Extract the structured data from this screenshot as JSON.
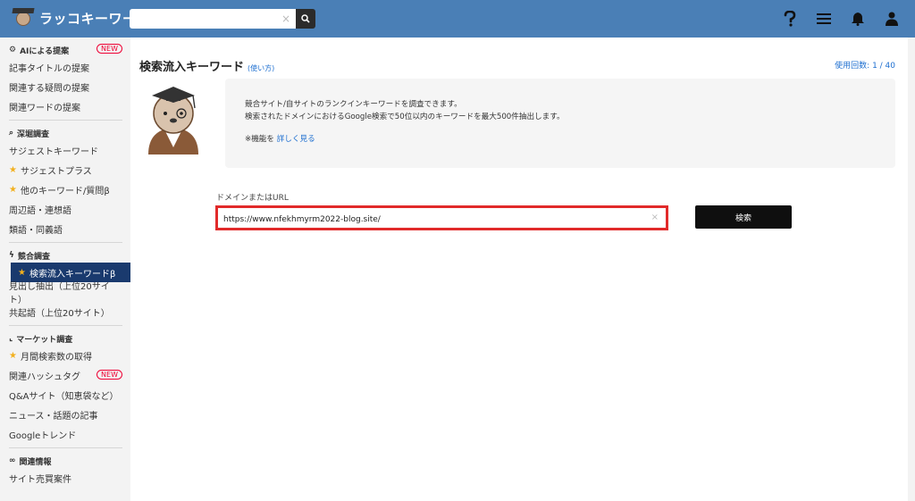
{
  "app": {
    "title": "ラッコキーワード"
  },
  "header": {
    "search_value": "",
    "icons": [
      "help-icon",
      "menu-icon",
      "bell-icon",
      "user-icon"
    ],
    "clear_glyph": "×"
  },
  "sidebar": {
    "sections": [
      {
        "title": "AIによる提案",
        "badge": "NEW",
        "items": [
          {
            "label": "記事タイトルの提案"
          },
          {
            "label": "関連する疑問の提案"
          },
          {
            "label": "関連ワードの提案"
          }
        ]
      },
      {
        "title": "深堀調査",
        "items": [
          {
            "label": "サジェストキーワード"
          },
          {
            "label": "サジェストプラス",
            "star": true
          },
          {
            "label": "他のキーワード/質問β",
            "star": true
          },
          {
            "label": "周辺語・連想語"
          },
          {
            "label": "類語・同義語"
          }
        ]
      },
      {
        "title": "競合調査",
        "items": [
          {
            "label": "検索流入キーワードβ",
            "star": true,
            "active": true
          },
          {
            "label": "見出し抽出（上位20サイト）"
          },
          {
            "label": "共起語（上位20サイト）"
          }
        ]
      },
      {
        "title": "マーケット調査",
        "items": [
          {
            "label": "月間検索数の取得",
            "star": true
          },
          {
            "label": "関連ハッシュタグ",
            "badge": "NEW"
          },
          {
            "label": "Q&Aサイト（知恵袋など）"
          },
          {
            "label": "ニュース・話題の記事"
          },
          {
            "label": "Googleトレンド"
          }
        ]
      },
      {
        "title": "関連情報",
        "items": [
          {
            "label": "サイト売買案件"
          }
        ]
      }
    ]
  },
  "main": {
    "title": "検索流入キーワード",
    "how_to_link": "(使い方)",
    "usage": "使用回数: 1 / 40",
    "info_line1": "競合サイト/自サイトのランクインキーワードを調査できます。",
    "info_line2": "検索されたドメインにおけるGoogle検索で50位以内のキーワードを最大500件抽出します。",
    "info_note_prefix": "※機能を ",
    "info_note_link": "詳しく見る",
    "field_label": "ドメインまたはURL",
    "field_value": "https://www.nfekhmyrm2022-blog.site/",
    "search_button": "検索"
  },
  "colors": {
    "topbar": "#4a7fb6",
    "active_item": "#1a3a6e",
    "highlight_border": "#e12a2a",
    "link": "#1e6fd0",
    "star": "#f2b01e",
    "new_badge": "#e03"
  }
}
